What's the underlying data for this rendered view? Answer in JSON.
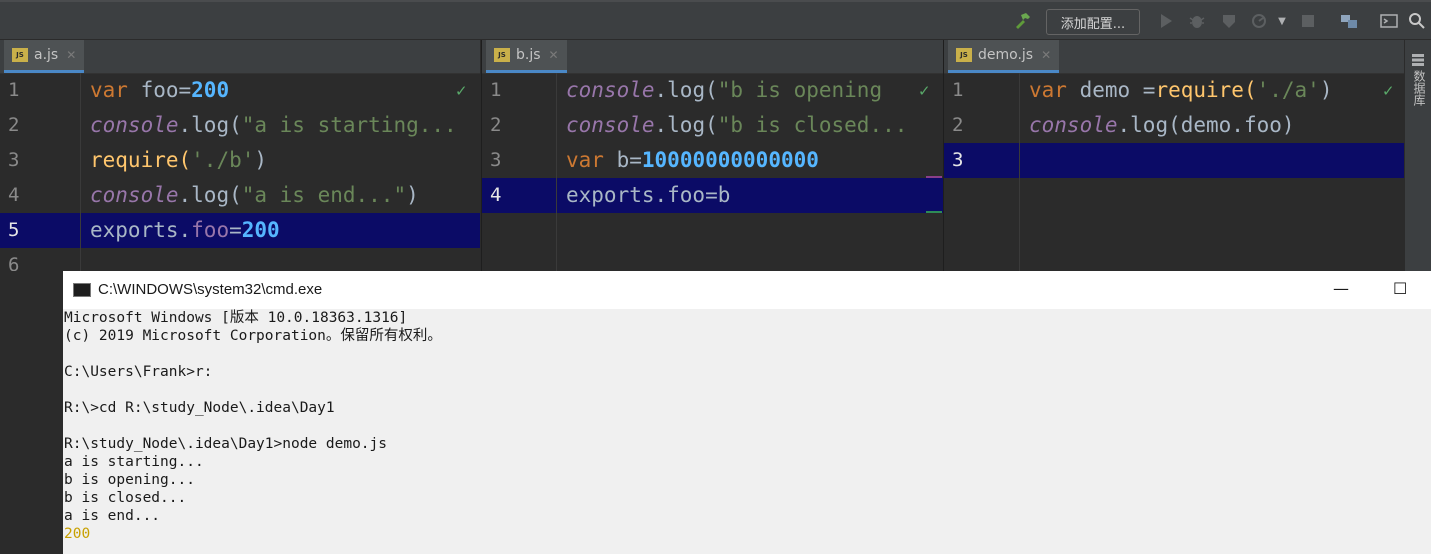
{
  "toolbar": {
    "run_config_label": "添加配置..."
  },
  "panes": [
    {
      "tab": "a.js",
      "line_numbers": [
        "1",
        "2",
        "3",
        "4",
        "5",
        "6"
      ],
      "current_line": 5,
      "lines": [
        [
          {
            "t": "var ",
            "c": "kw"
          },
          {
            "t": "foo=",
            "c": "plain"
          },
          {
            "t": "200",
            "c": "num2"
          }
        ],
        [
          {
            "t": "console",
            "c": "obj"
          },
          {
            "t": ".log(",
            "c": "plain"
          },
          {
            "t": "\"a is starting...",
            "c": "str"
          }
        ],
        [
          {
            "t": "require(",
            "c": "fn"
          },
          {
            "t": "'./b'",
            "c": "str"
          },
          {
            "t": ")",
            "c": "plain"
          }
        ],
        [
          {
            "t": "console",
            "c": "obj"
          },
          {
            "t": ".log(",
            "c": "plain"
          },
          {
            "t": "\"a is end...\"",
            "c": "str"
          },
          {
            "t": ")",
            "c": "plain"
          }
        ],
        [
          {
            "t": "exports.",
            "c": "plain"
          },
          {
            "t": "foo",
            "c": "prop"
          },
          {
            "t": "=",
            "c": "plain"
          },
          {
            "t": "200",
            "c": "num2"
          }
        ],
        []
      ]
    },
    {
      "tab": "b.js",
      "line_numbers": [
        "1",
        "2",
        "3",
        "4"
      ],
      "current_line": 4,
      "lines": [
        [
          {
            "t": "console",
            "c": "obj"
          },
          {
            "t": ".log(",
            "c": "plain"
          },
          {
            "t": "\"b is opening",
            "c": "str"
          }
        ],
        [
          {
            "t": "console",
            "c": "obj"
          },
          {
            "t": ".log(",
            "c": "plain"
          },
          {
            "t": "\"b is closed...",
            "c": "str"
          }
        ],
        [
          {
            "t": "var ",
            "c": "kw"
          },
          {
            "t": "b",
            "c": "plain"
          },
          {
            "t": "=",
            "c": "plain"
          },
          {
            "t": "10000000000000",
            "c": "num2"
          }
        ],
        [
          {
            "t": "exports.foo=b",
            "c": "plain"
          }
        ]
      ]
    },
    {
      "tab": "demo.js",
      "line_numbers": [
        "1",
        "2",
        "3"
      ],
      "current_line": 3,
      "lines": [
        [
          {
            "t": "var ",
            "c": "kw"
          },
          {
            "t": "demo ",
            "c": "plain"
          },
          {
            "t": "=",
            "c": "plain"
          },
          {
            "t": "require(",
            "c": "fn"
          },
          {
            "t": "'./a'",
            "c": "str"
          },
          {
            "t": ")",
            "c": "plain"
          }
        ],
        [
          {
            "t": "console",
            "c": "obj"
          },
          {
            "t": ".log(demo.foo)",
            "c": "plain"
          }
        ],
        []
      ]
    }
  ],
  "sidebar_label": "数据库",
  "cmd": {
    "title": "C:\\WINDOWS\\system32\\cmd.exe",
    "lines": [
      "Microsoft Windows [版本 10.0.18363.1316]",
      "(c) 2019 Microsoft Corporation。保留所有权利。",
      "",
      "C:\\Users\\Frank>r:",
      "",
      "R:\\>cd R:\\study_Node\\.idea\\Day1",
      "",
      "R:\\study_Node\\.idea\\Day1>node demo.js",
      "a is starting...",
      "b is opening...",
      "b is closed...",
      "a is end...",
      "200"
    ]
  }
}
